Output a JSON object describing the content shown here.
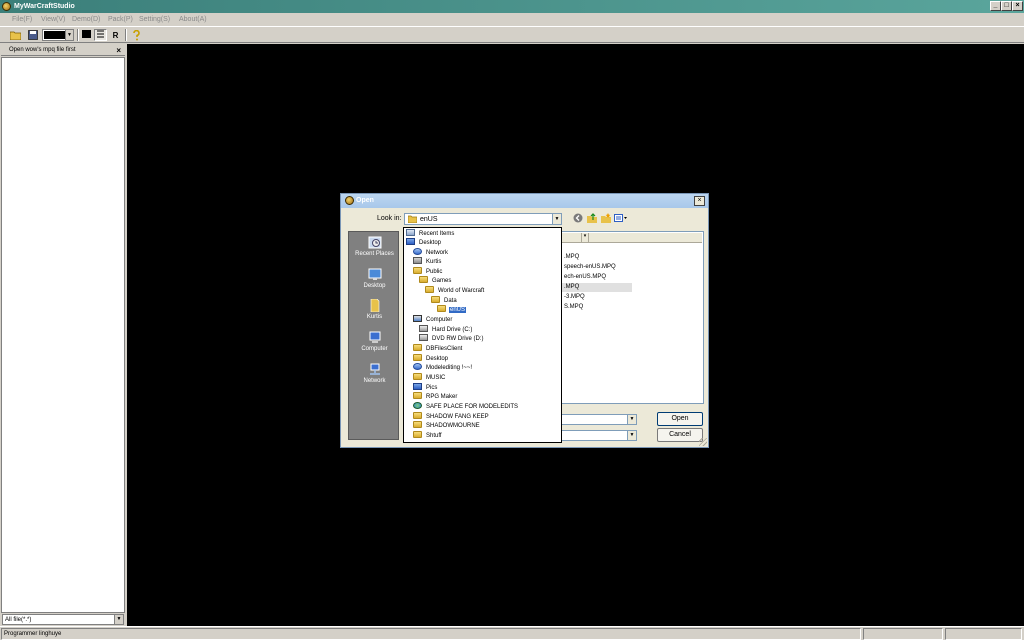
{
  "window": {
    "title": "MyWarCraftStudio",
    "controls": {
      "minimize": "_",
      "maximize": "□",
      "close": "×"
    }
  },
  "menu": {
    "items": [
      "File(F)",
      "View(V)",
      "Demo(D)",
      "Pack(P)",
      "Setting(S)",
      "About(A)"
    ]
  },
  "toolbar": {
    "items": [
      "open-folder-icon",
      "save-icon",
      "color-picker",
      "fill-icon",
      "lines-icon",
      "R",
      "help-icon"
    ],
    "r_label": "R",
    "current_color": "#000000"
  },
  "left_panel": {
    "header": "Open wow's mpq file first",
    "close": "×",
    "filter_value": "All file(*.*)"
  },
  "status": {
    "text": "Programmer linghuye"
  },
  "dialog": {
    "title": "Open",
    "close": "×",
    "look_in_label": "Look in:",
    "look_in_value": "enUS",
    "places": [
      "Recent Places",
      "Desktop",
      "Kurtis",
      "Computer",
      "Network"
    ],
    "files": [
      ".MPQ",
      "speech-enUS.MPQ",
      "ech-enUS.MPQ",
      ".MPQ",
      "-3.MPQ",
      "S.MPQ"
    ],
    "highlighted_file_index": 3,
    "open_button": "Open",
    "cancel_button": "Cancel",
    "filename_value": "",
    "filetype_value": ""
  },
  "lookin_dropdown": {
    "items": [
      {
        "label": "Recent Items",
        "icon": "recent-icon",
        "indent": 0
      },
      {
        "label": "Desktop",
        "icon": "desktop-icon",
        "indent": 0
      },
      {
        "label": "Network",
        "icon": "network-icon",
        "indent": 1
      },
      {
        "label": "Kurtis",
        "icon": "user-folder-icon",
        "indent": 1
      },
      {
        "label": "Public",
        "icon": "folder-icon",
        "indent": 1
      },
      {
        "label": "Games",
        "icon": "folder-icon",
        "indent": 2
      },
      {
        "label": "World of Warcraft",
        "icon": "folder-icon",
        "indent": 3
      },
      {
        "label": "Data",
        "icon": "folder-icon",
        "indent": 4
      },
      {
        "label": "enUS",
        "icon": "folder-icon",
        "indent": 5,
        "selected": true
      },
      {
        "label": "Computer",
        "icon": "computer-icon",
        "indent": 1
      },
      {
        "label": "Hard Drive (C:)",
        "icon": "drive-icon",
        "indent": 2
      },
      {
        "label": "DVD RW Drive (D:)",
        "icon": "dvd-icon",
        "indent": 2
      },
      {
        "label": "DBFilesClient",
        "icon": "folder-icon",
        "indent": 1
      },
      {
        "label": "Desktop",
        "icon": "folder-icon",
        "indent": 1
      },
      {
        "label": "Modelediting !~~!",
        "icon": "folder-icon",
        "indent": 1
      },
      {
        "label": "MUSIC",
        "icon": "folder-icon",
        "indent": 1
      },
      {
        "label": "Pics",
        "icon": "folder-icon",
        "indent": 1
      },
      {
        "label": "RPG Maker",
        "icon": "folder-icon",
        "indent": 1
      },
      {
        "label": "SAFE PLACE FOR MODELEDITS",
        "icon": "globe-icon",
        "indent": 1
      },
      {
        "label": "SHADOW FANG KEEP",
        "icon": "folder-icon",
        "indent": 1
      },
      {
        "label": "SHADOWMOURNE",
        "icon": "folder-icon",
        "indent": 1
      },
      {
        "label": "Shtuff",
        "icon": "folder-icon",
        "indent": 1
      }
    ]
  },
  "colors": {
    "titlebar": "#3b7f7a",
    "canvas": "#000000",
    "selection": "#316ac5",
    "dialog_title": "#a8c8ea"
  }
}
